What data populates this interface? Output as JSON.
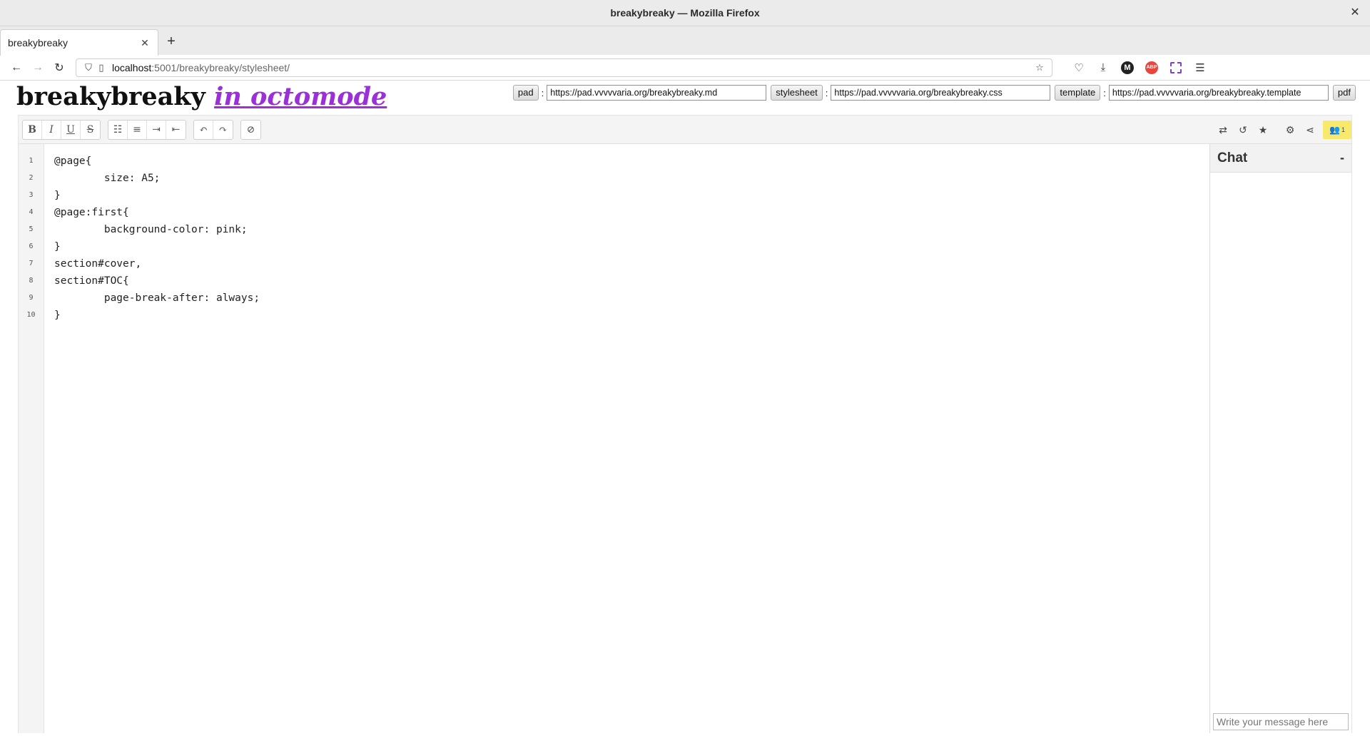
{
  "window": {
    "title": "breakybreaky — Mozilla Firefox"
  },
  "tabs": [
    {
      "label": "breakybreaky"
    }
  ],
  "navbar": {
    "url_host": "localhost",
    "url_rest": ":5001/breakybreaky/stylesheet/",
    "avatar_letter": "M",
    "abp_label": "ABP"
  },
  "header": {
    "brand_main": "breakybreaky",
    "brand_link": "in octomode"
  },
  "fields": {
    "pad_label": "pad",
    "pad_value": "https://pad.vvvvvaria.org/breakybreaky.md",
    "stylesheet_label": "stylesheet",
    "stylesheet_value": "https://pad.vvvvvaria.org/breakybreaky.css",
    "template_label": "template",
    "template_value": "https://pad.vvvvvaria.org/breakybreaky.template",
    "pdf_label": "pdf",
    "colon": ":"
  },
  "toolbar": {
    "bold": "B",
    "italic": "I",
    "underline": "U",
    "strike": "S",
    "user_count": "1"
  },
  "editor": {
    "line_numbers": [
      "1",
      "2",
      "3",
      "4",
      "5",
      "6",
      "7",
      "8",
      "9",
      "10"
    ],
    "lines": [
      "@page{",
      "        size: A5;",
      "}",
      "@page:first{",
      "        background-color: pink;",
      "}",
      "section#cover,",
      "section#TOC{",
      "        page-break-after: always;",
      "}"
    ]
  },
  "chat": {
    "title": "Chat",
    "minimize": "-",
    "input_placeholder": "Write your message here"
  }
}
